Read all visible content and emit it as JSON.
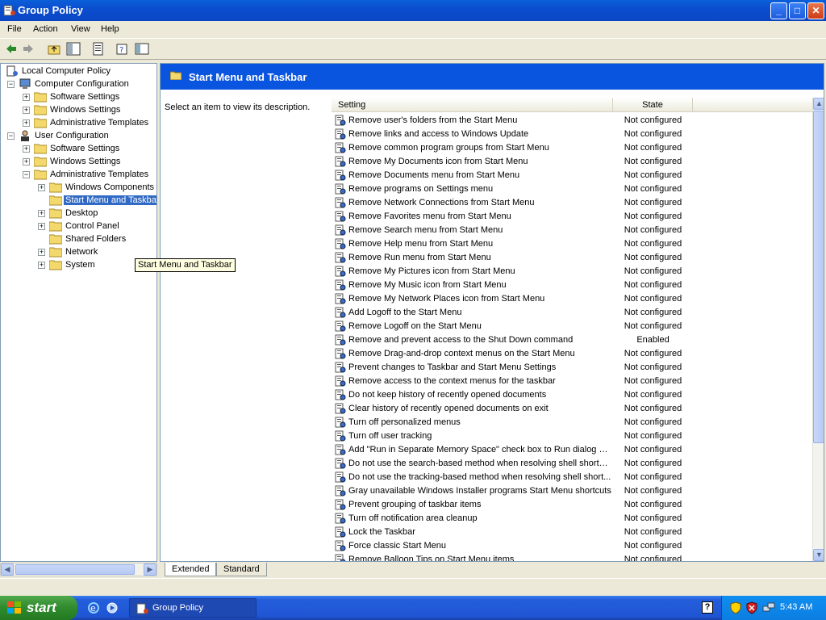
{
  "window": {
    "title": "Group Policy",
    "minimize": "_",
    "maximize": "□",
    "close": "✕"
  },
  "menu": [
    "File",
    "Action",
    "View",
    "Help"
  ],
  "tree": [
    {
      "label": "Local Computer Policy",
      "level": 0,
      "expander": "",
      "icon": "computer-policy-icon"
    },
    {
      "label": "Computer Configuration",
      "level": 1,
      "expander": "−",
      "icon": "computer-icon"
    },
    {
      "label": "Software Settings",
      "level": 2,
      "expander": "+",
      "icon": "folder-icon"
    },
    {
      "label": "Windows Settings",
      "level": 2,
      "expander": "+",
      "icon": "folder-icon"
    },
    {
      "label": "Administrative Templates",
      "level": 2,
      "expander": "+",
      "icon": "folder-icon"
    },
    {
      "label": "User Configuration",
      "level": 1,
      "expander": "−",
      "icon": "user-icon"
    },
    {
      "label": "Software Settings",
      "level": 2,
      "expander": "+",
      "icon": "folder-icon"
    },
    {
      "label": "Windows Settings",
      "level": 2,
      "expander": "+",
      "icon": "folder-icon"
    },
    {
      "label": "Administrative Templates",
      "level": 2,
      "expander": "−",
      "icon": "folder-icon"
    },
    {
      "label": "Windows Components",
      "level": 3,
      "expander": "+",
      "icon": "folder-icon"
    },
    {
      "label": "Start Menu and Taskba",
      "level": 3,
      "expander": "",
      "icon": "folder-open-icon",
      "selected": true
    },
    {
      "label": "Desktop",
      "level": 3,
      "expander": "+",
      "icon": "folder-icon"
    },
    {
      "label": "Control Panel",
      "level": 3,
      "expander": "+",
      "icon": "folder-icon"
    },
    {
      "label": "Shared Folders",
      "level": 3,
      "expander": "",
      "icon": "folder-icon"
    },
    {
      "label": "Network",
      "level": 3,
      "expander": "+",
      "icon": "folder-icon"
    },
    {
      "label": "System",
      "level": 3,
      "expander": "+",
      "icon": "folder-icon"
    }
  ],
  "tooltip": "Start Menu and Taskbar",
  "pane": {
    "title": "Start Menu and Taskbar",
    "description": "Select an item to view its description.",
    "columns": {
      "setting": "Setting",
      "state": "State"
    }
  },
  "settings": [
    {
      "name": "Remove user's folders from the Start Menu",
      "state": "Not configured"
    },
    {
      "name": "Remove links and access to Windows Update",
      "state": "Not configured"
    },
    {
      "name": "Remove common program groups from Start Menu",
      "state": "Not configured"
    },
    {
      "name": "Remove My Documents icon from Start Menu",
      "state": "Not configured"
    },
    {
      "name": "Remove Documents menu from Start Menu",
      "state": "Not configured"
    },
    {
      "name": "Remove programs on Settings menu",
      "state": "Not configured"
    },
    {
      "name": "Remove Network Connections from Start Menu",
      "state": "Not configured"
    },
    {
      "name": "Remove Favorites menu from Start Menu",
      "state": "Not configured"
    },
    {
      "name": "Remove Search menu from Start Menu",
      "state": "Not configured"
    },
    {
      "name": "Remove Help menu from Start Menu",
      "state": "Not configured"
    },
    {
      "name": "Remove Run menu from Start Menu",
      "state": "Not configured"
    },
    {
      "name": "Remove My Pictures icon from Start Menu",
      "state": "Not configured"
    },
    {
      "name": "Remove My Music icon from Start Menu",
      "state": "Not configured"
    },
    {
      "name": "Remove My Network Places icon from Start Menu",
      "state": "Not configured"
    },
    {
      "name": "Add Logoff to the Start Menu",
      "state": "Not configured"
    },
    {
      "name": "Remove Logoff on the Start Menu",
      "state": "Not configured"
    },
    {
      "name": "Remove and prevent access to the Shut Down command",
      "state": "Enabled"
    },
    {
      "name": "Remove Drag-and-drop context menus on the Start Menu",
      "state": "Not configured"
    },
    {
      "name": "Prevent changes to Taskbar and Start Menu Settings",
      "state": "Not configured"
    },
    {
      "name": "Remove access to the context menus for the taskbar",
      "state": "Not configured"
    },
    {
      "name": "Do not keep history of recently opened documents",
      "state": "Not configured"
    },
    {
      "name": "Clear history of recently opened documents on exit",
      "state": "Not configured"
    },
    {
      "name": "Turn off personalized menus",
      "state": "Not configured"
    },
    {
      "name": "Turn off user tracking",
      "state": "Not configured"
    },
    {
      "name": "Add \"Run in Separate Memory Space\" check box to Run dialog box",
      "state": "Not configured"
    },
    {
      "name": "Do not use the search-based method when resolving shell shortcuts",
      "state": "Not configured"
    },
    {
      "name": "Do not use the tracking-based method when resolving shell short...",
      "state": "Not configured"
    },
    {
      "name": "Gray unavailable Windows Installer programs Start Menu shortcuts",
      "state": "Not configured"
    },
    {
      "name": "Prevent grouping of taskbar items",
      "state": "Not configured"
    },
    {
      "name": "Turn off notification area cleanup",
      "state": "Not configured"
    },
    {
      "name": "Lock the Taskbar",
      "state": "Not configured"
    },
    {
      "name": "Force classic Start Menu",
      "state": "Not configured"
    },
    {
      "name": "Remove Balloon Tips on Start Menu items",
      "state": "Not configured"
    }
  ],
  "tabs": [
    "Extended",
    "Standard"
  ],
  "taskbar": {
    "start": "start",
    "task": "Group Policy",
    "clock": "5:43 AM"
  },
  "colors": {
    "titlebar": "#0a4fd0",
    "header": "#0a55e0",
    "selection": "#316ac5",
    "start": "#2f8a2d"
  }
}
